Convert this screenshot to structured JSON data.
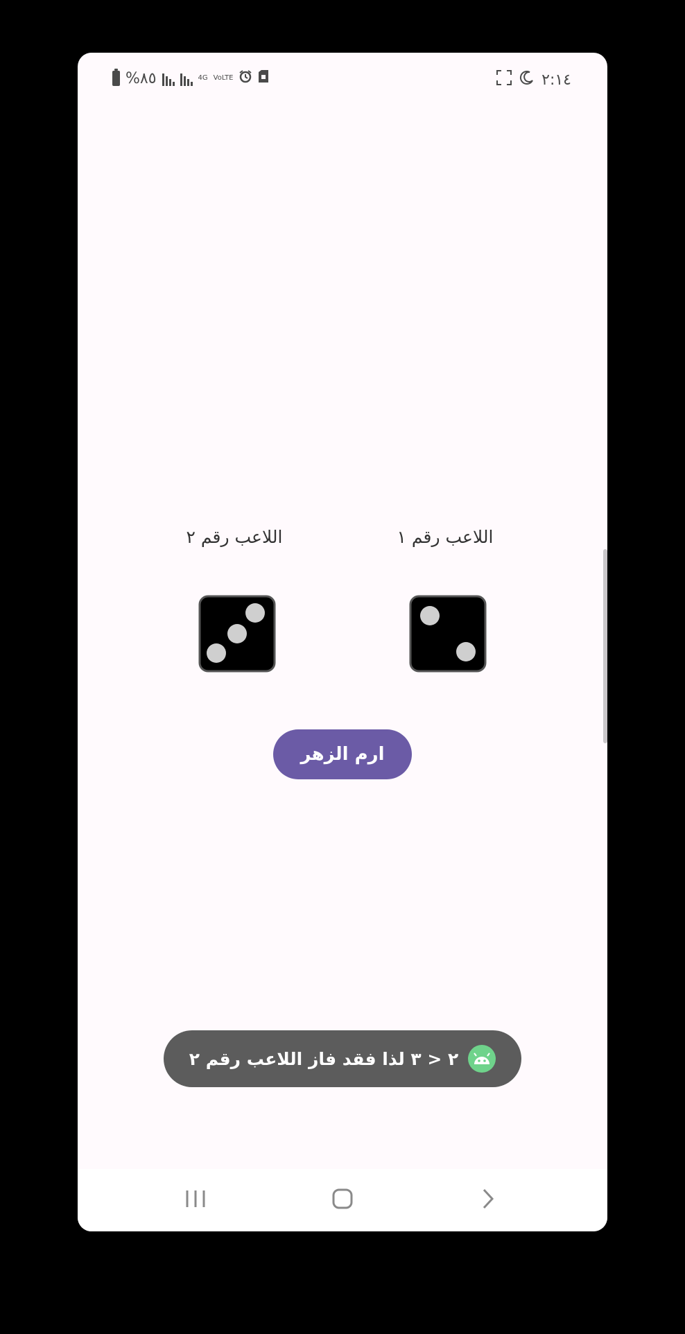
{
  "status_bar": {
    "battery_percent": "%٨٥",
    "network_label": "4G",
    "volte_label": "VoLTE",
    "time": "٢:١٤"
  },
  "players": {
    "player1_label": "اللاعب رقم ١",
    "player2_label": "اللاعب رقم ٢",
    "player1_dice_value": 2,
    "player2_dice_value": 3
  },
  "roll_button_label": "ارم الزهر",
  "toast_message": "٢ < ٣ لذا فقد فاز اللاعب رقم ٢",
  "icons": {
    "battery": "battery-icon",
    "signal": "signal-icon",
    "alarm": "alarm-icon",
    "sim": "sim-icon",
    "moon": "moon-icon",
    "expand": "expand-icon",
    "android": "android-icon",
    "recents": "recents-icon",
    "home": "home-icon",
    "back": "back-icon"
  },
  "colors": {
    "button": "#6b5ba6",
    "toast_bg": "#5c5c5c",
    "android_icon": "#6fd38b",
    "background": "#fffafd"
  }
}
